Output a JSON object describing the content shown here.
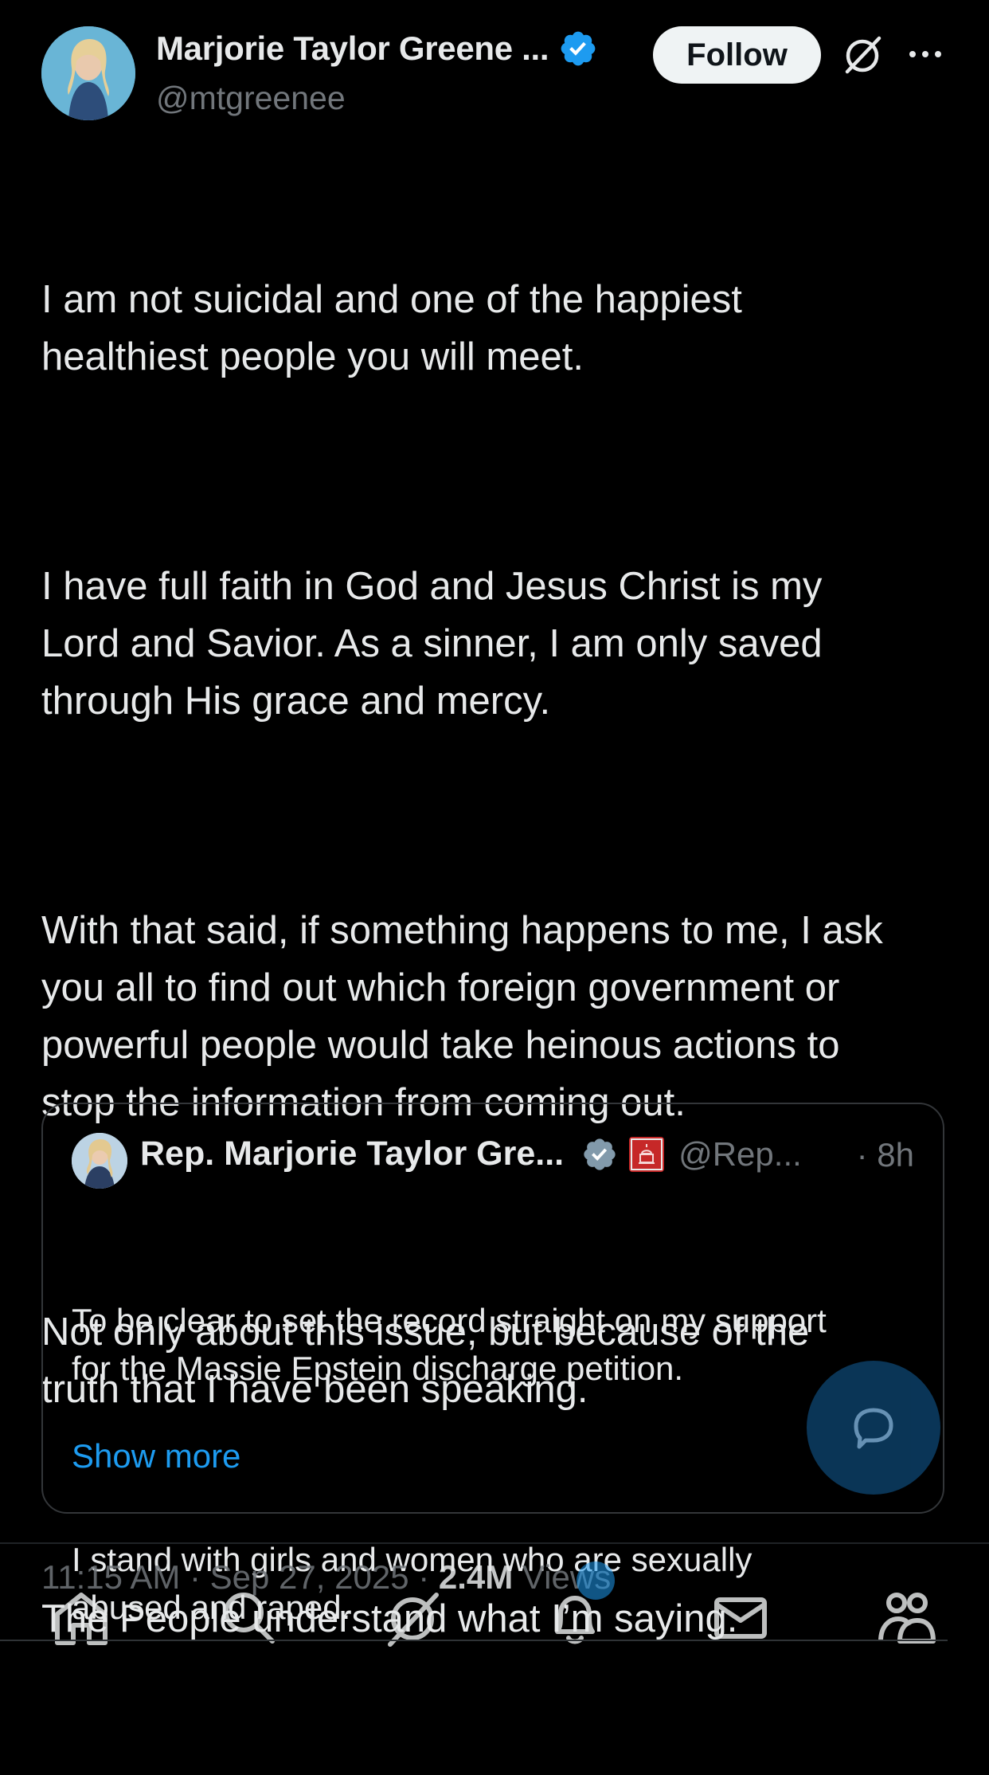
{
  "author": {
    "display_name": "Marjorie Taylor Greene ...",
    "handle": "@mtgreenee"
  },
  "header": {
    "follow_label": "Follow"
  },
  "tweet": {
    "paragraphs": [
      "I am not suicidal and one of the happiest\nhealthiest people you will meet.",
      "I have full faith in God and Jesus Christ is my\nLord and Savior. As a sinner, I am only saved\nthrough His grace and mercy.",
      "With that said, if something happens to me, I ask\nyou all to find out which foreign government or\npowerful people would take heinous actions to\nstop the information from coming out.",
      "Not only about this issue, but because of the\ntruth that I have been speaking.",
      "The People understand what I’m saying."
    ]
  },
  "quoted": {
    "display_name": "Rep. Marjorie Taylor Gre...",
    "handle": "@Rep...",
    "time": "· 8h",
    "paragraphs": [
      "To be clear to set the record straight on my support\nfor the Massie Epstein discharge petition.",
      "I stand with girls and women who are sexually\nabused and raped."
    ],
    "show_more": "Show more"
  },
  "meta": {
    "time": "11:15 AM · Sep 27, 2025 · ",
    "views_count": "2.4M",
    "views_label": " Views"
  },
  "colors": {
    "background": "#000000",
    "text": "#e7e9ea",
    "secondary": "#71767b",
    "accent": "#1d9bf0",
    "verified": "#1d9bf0"
  },
  "icons": [
    "verified-badge-icon",
    "grok-icon",
    "more-icon",
    "reply-icon",
    "home-icon",
    "search-icon",
    "grok-tab-icon",
    "bell-icon",
    "mail-icon",
    "communities-icon"
  ]
}
